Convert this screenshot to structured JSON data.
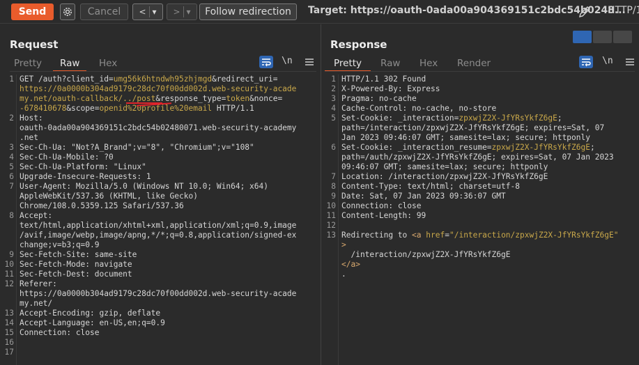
{
  "toolbar": {
    "send_label": "Send",
    "cancel_label": "Cancel",
    "back_label": "<",
    "forward_label": ">",
    "dropdown_glyph": "▾",
    "follow_label": "Follow redirection",
    "target_text": "Target: https://oauth-0ada00a904369151c2bdc54b0248...",
    "protocol_label": "HTTP/1"
  },
  "request": {
    "title": "Request",
    "tabs": [
      "Pretty",
      "Raw",
      "Hex"
    ],
    "active_tab": "Raw",
    "lines": [
      {
        "n": "1",
        "html": "GET /auth?client_id=<span class='u'>umg56k6htndwh95zhjmgd</span>&amp;redirect_uri="
      },
      {
        "n": "",
        "html": "<span class='u'>https://0a0000b304ad9179c28dc70f00dd002d.web-security-acade</span>"
      },
      {
        "n": "",
        "html": "<span class='u'>my.net/oauth-callback/../post</span>&amp;response_type=<span class='u'>token</span>&amp;nonce="
      },
      {
        "n": "",
        "html": "<span class='u'>-678410678</span>&amp;scope=<span class='u'>openid%20profile%20email</span> HTTP/1.1"
      },
      {
        "n": "2",
        "html": "Host:"
      },
      {
        "n": "",
        "html": "oauth-0ada00a904369151c2bdc54b02480071.web-security-academy"
      },
      {
        "n": "",
        "html": ".net"
      },
      {
        "n": "3",
        "html": "Sec-Ch-Ua: \"Not?A_Brand\";v=\"8\", \"Chromium\";v=\"108\""
      },
      {
        "n": "4",
        "html": "Sec-Ch-Ua-Mobile: ?0"
      },
      {
        "n": "5",
        "html": "Sec-Ch-Ua-Platform: \"Linux\""
      },
      {
        "n": "6",
        "html": "Upgrade-Insecure-Requests: 1"
      },
      {
        "n": "7",
        "html": "User-Agent: Mozilla/5.0 (Windows NT 10.0; Win64; x64)"
      },
      {
        "n": "",
        "html": "AppleWebKit/537.36 (KHTML, like Gecko)"
      },
      {
        "n": "",
        "html": "Chrome/108.0.5359.125 Safari/537.36"
      },
      {
        "n": "8",
        "html": "Accept:"
      },
      {
        "n": "",
        "html": "text/html,application/xhtml+xml,application/xml;q=0.9,image"
      },
      {
        "n": "",
        "html": "/avif,image/webp,image/apng,*/*;q=0.8,application/signed-ex"
      },
      {
        "n": "",
        "html": "change;v=b3;q=0.9"
      },
      {
        "n": "9",
        "html": "Sec-Fetch-Site: same-site"
      },
      {
        "n": "10",
        "html": "Sec-Fetch-Mode: navigate"
      },
      {
        "n": "11",
        "html": "Sec-Fetch-Dest: document"
      },
      {
        "n": "12",
        "html": "Referer:"
      },
      {
        "n": "",
        "html": "https://0a0000b304ad9179c28dc70f00dd002d.web-security-acade"
      },
      {
        "n": "",
        "html": "my.net/"
      },
      {
        "n": "13",
        "html": "Accept-Encoding: gzip, deflate"
      },
      {
        "n": "14",
        "html": "Accept-Language: en-US,en;q=0.9"
      },
      {
        "n": "15",
        "html": "Connection: close"
      },
      {
        "n": "16",
        "html": ""
      },
      {
        "n": "17",
        "html": ""
      }
    ]
  },
  "response": {
    "title": "Response",
    "tabs": [
      "Pretty",
      "Raw",
      "Hex",
      "Render"
    ],
    "active_tab": "Pretty",
    "lines": [
      {
        "n": "1",
        "html": "HTTP/1.1 302 Found"
      },
      {
        "n": "2",
        "html": "X-Powered-By: Express"
      },
      {
        "n": "3",
        "html": "Pragma: no-cache"
      },
      {
        "n": "4",
        "html": "Cache-Control: no-cache, no-store"
      },
      {
        "n": "5",
        "html": "Set-Cookie: _interaction=<span class='u'>zpxwjZ2X-JfYRsYkfZ6gE</span>;"
      },
      {
        "n": "",
        "html": "path=/interaction/zpxwjZ2X-JfYRsYkfZ6gE; expires=Sat, 07"
      },
      {
        "n": "",
        "html": "Jan 2023 09:46:07 GMT; samesite=lax; secure; httponly"
      },
      {
        "n": "6",
        "html": "Set-Cookie: _interaction_resume=<span class='u'>zpxwjZ2X-JfYRsYkfZ6gE</span>;"
      },
      {
        "n": "",
        "html": "path=/auth/zpxwjZ2X-JfYRsYkfZ6gE; expires=Sat, 07 Jan 2023"
      },
      {
        "n": "",
        "html": "09:46:07 GMT; samesite=lax; secure; httponly"
      },
      {
        "n": "7",
        "html": "Location: /interaction/zpxwjZ2X-JfYRsYkfZ6gE"
      },
      {
        "n": "8",
        "html": "Content-Type: text/html; charset=utf-8"
      },
      {
        "n": "9",
        "html": "Date: Sat, 07 Jan 2023 09:36:07 GMT"
      },
      {
        "n": "10",
        "html": "Connection: close"
      },
      {
        "n": "11",
        "html": "Content-Length: 99"
      },
      {
        "n": "12",
        "html": ""
      },
      {
        "n": "13",
        "html": "Redirecting to <span class='tagc'>&lt;a</span> <span class='u'>href</span>=<span class='u'>\"/interaction/zpxwjZ2X-JfYRsYkfZ6gE\"</span>"
      },
      {
        "n": "",
        "html": "<span class='tagc'>&gt;</span>"
      },
      {
        "n": "",
        "html": "  /interaction/zpxwjZ2X-JfYRsYkfZ6gE"
      },
      {
        "n": "",
        "html": "<span class='tagc'>&lt;/a&gt;</span>"
      },
      {
        "n": "",
        "html": "."
      }
    ]
  },
  "colors": {
    "accent": "#e95c2c",
    "blue": "#2f66b3",
    "value_orange": "#c9a84a",
    "annotation_red": "#e0242b"
  }
}
